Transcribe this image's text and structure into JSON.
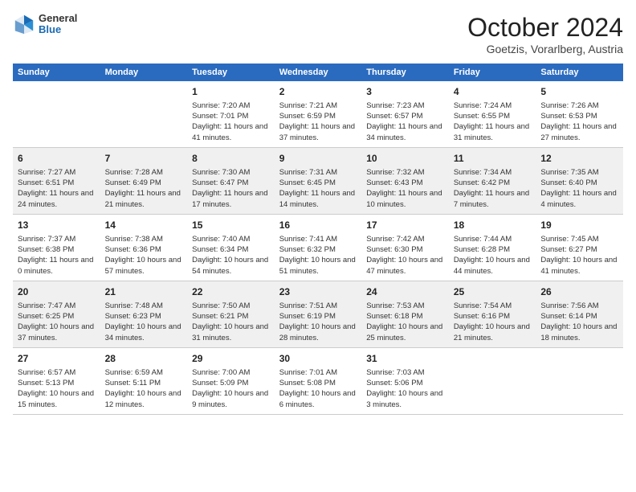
{
  "logo": {
    "general": "General",
    "blue": "Blue"
  },
  "title": "October 2024",
  "location": "Goetzis, Vorarlberg, Austria",
  "days_of_week": [
    "Sunday",
    "Monday",
    "Tuesday",
    "Wednesday",
    "Thursday",
    "Friday",
    "Saturday"
  ],
  "weeks": [
    [
      {
        "num": "",
        "info": ""
      },
      {
        "num": "",
        "info": ""
      },
      {
        "num": "1",
        "info": "Sunrise: 7:20 AM\nSunset: 7:01 PM\nDaylight: 11 hours and 41 minutes."
      },
      {
        "num": "2",
        "info": "Sunrise: 7:21 AM\nSunset: 6:59 PM\nDaylight: 11 hours and 37 minutes."
      },
      {
        "num": "3",
        "info": "Sunrise: 7:23 AM\nSunset: 6:57 PM\nDaylight: 11 hours and 34 minutes."
      },
      {
        "num": "4",
        "info": "Sunrise: 7:24 AM\nSunset: 6:55 PM\nDaylight: 11 hours and 31 minutes."
      },
      {
        "num": "5",
        "info": "Sunrise: 7:26 AM\nSunset: 6:53 PM\nDaylight: 11 hours and 27 minutes."
      }
    ],
    [
      {
        "num": "6",
        "info": "Sunrise: 7:27 AM\nSunset: 6:51 PM\nDaylight: 11 hours and 24 minutes."
      },
      {
        "num": "7",
        "info": "Sunrise: 7:28 AM\nSunset: 6:49 PM\nDaylight: 11 hours and 21 minutes."
      },
      {
        "num": "8",
        "info": "Sunrise: 7:30 AM\nSunset: 6:47 PM\nDaylight: 11 hours and 17 minutes."
      },
      {
        "num": "9",
        "info": "Sunrise: 7:31 AM\nSunset: 6:45 PM\nDaylight: 11 hours and 14 minutes."
      },
      {
        "num": "10",
        "info": "Sunrise: 7:32 AM\nSunset: 6:43 PM\nDaylight: 11 hours and 10 minutes."
      },
      {
        "num": "11",
        "info": "Sunrise: 7:34 AM\nSunset: 6:42 PM\nDaylight: 11 hours and 7 minutes."
      },
      {
        "num": "12",
        "info": "Sunrise: 7:35 AM\nSunset: 6:40 PM\nDaylight: 11 hours and 4 minutes."
      }
    ],
    [
      {
        "num": "13",
        "info": "Sunrise: 7:37 AM\nSunset: 6:38 PM\nDaylight: 11 hours and 0 minutes."
      },
      {
        "num": "14",
        "info": "Sunrise: 7:38 AM\nSunset: 6:36 PM\nDaylight: 10 hours and 57 minutes."
      },
      {
        "num": "15",
        "info": "Sunrise: 7:40 AM\nSunset: 6:34 PM\nDaylight: 10 hours and 54 minutes."
      },
      {
        "num": "16",
        "info": "Sunrise: 7:41 AM\nSunset: 6:32 PM\nDaylight: 10 hours and 51 minutes."
      },
      {
        "num": "17",
        "info": "Sunrise: 7:42 AM\nSunset: 6:30 PM\nDaylight: 10 hours and 47 minutes."
      },
      {
        "num": "18",
        "info": "Sunrise: 7:44 AM\nSunset: 6:28 PM\nDaylight: 10 hours and 44 minutes."
      },
      {
        "num": "19",
        "info": "Sunrise: 7:45 AM\nSunset: 6:27 PM\nDaylight: 10 hours and 41 minutes."
      }
    ],
    [
      {
        "num": "20",
        "info": "Sunrise: 7:47 AM\nSunset: 6:25 PM\nDaylight: 10 hours and 37 minutes."
      },
      {
        "num": "21",
        "info": "Sunrise: 7:48 AM\nSunset: 6:23 PM\nDaylight: 10 hours and 34 minutes."
      },
      {
        "num": "22",
        "info": "Sunrise: 7:50 AM\nSunset: 6:21 PM\nDaylight: 10 hours and 31 minutes."
      },
      {
        "num": "23",
        "info": "Sunrise: 7:51 AM\nSunset: 6:19 PM\nDaylight: 10 hours and 28 minutes."
      },
      {
        "num": "24",
        "info": "Sunrise: 7:53 AM\nSunset: 6:18 PM\nDaylight: 10 hours and 25 minutes."
      },
      {
        "num": "25",
        "info": "Sunrise: 7:54 AM\nSunset: 6:16 PM\nDaylight: 10 hours and 21 minutes."
      },
      {
        "num": "26",
        "info": "Sunrise: 7:56 AM\nSunset: 6:14 PM\nDaylight: 10 hours and 18 minutes."
      }
    ],
    [
      {
        "num": "27",
        "info": "Sunrise: 6:57 AM\nSunset: 5:13 PM\nDaylight: 10 hours and 15 minutes."
      },
      {
        "num": "28",
        "info": "Sunrise: 6:59 AM\nSunset: 5:11 PM\nDaylight: 10 hours and 12 minutes."
      },
      {
        "num": "29",
        "info": "Sunrise: 7:00 AM\nSunset: 5:09 PM\nDaylight: 10 hours and 9 minutes."
      },
      {
        "num": "30",
        "info": "Sunrise: 7:01 AM\nSunset: 5:08 PM\nDaylight: 10 hours and 6 minutes."
      },
      {
        "num": "31",
        "info": "Sunrise: 7:03 AM\nSunset: 5:06 PM\nDaylight: 10 hours and 3 minutes."
      },
      {
        "num": "",
        "info": ""
      },
      {
        "num": "",
        "info": ""
      }
    ]
  ]
}
